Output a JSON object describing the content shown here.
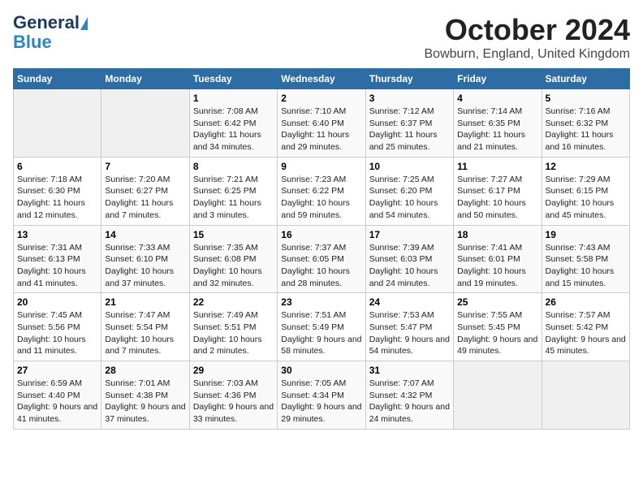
{
  "header": {
    "logo_line1": "General",
    "logo_line2": "Blue",
    "title": "October 2024",
    "subtitle": "Bowburn, England, United Kingdom"
  },
  "weekdays": [
    "Sunday",
    "Monday",
    "Tuesday",
    "Wednesday",
    "Thursday",
    "Friday",
    "Saturday"
  ],
  "weeks": [
    [
      {
        "day": "",
        "empty": true
      },
      {
        "day": "",
        "empty": true
      },
      {
        "day": "1",
        "sunrise": "7:08 AM",
        "sunset": "6:42 PM",
        "daylight": "11 hours and 34 minutes."
      },
      {
        "day": "2",
        "sunrise": "7:10 AM",
        "sunset": "6:40 PM",
        "daylight": "11 hours and 29 minutes."
      },
      {
        "day": "3",
        "sunrise": "7:12 AM",
        "sunset": "6:37 PM",
        "daylight": "11 hours and 25 minutes."
      },
      {
        "day": "4",
        "sunrise": "7:14 AM",
        "sunset": "6:35 PM",
        "daylight": "11 hours and 21 minutes."
      },
      {
        "day": "5",
        "sunrise": "7:16 AM",
        "sunset": "6:32 PM",
        "daylight": "11 hours and 16 minutes."
      }
    ],
    [
      {
        "day": "6",
        "sunrise": "7:18 AM",
        "sunset": "6:30 PM",
        "daylight": "11 hours and 12 minutes."
      },
      {
        "day": "7",
        "sunrise": "7:20 AM",
        "sunset": "6:27 PM",
        "daylight": "11 hours and 7 minutes."
      },
      {
        "day": "8",
        "sunrise": "7:21 AM",
        "sunset": "6:25 PM",
        "daylight": "11 hours and 3 minutes."
      },
      {
        "day": "9",
        "sunrise": "7:23 AM",
        "sunset": "6:22 PM",
        "daylight": "10 hours and 59 minutes."
      },
      {
        "day": "10",
        "sunrise": "7:25 AM",
        "sunset": "6:20 PM",
        "daylight": "10 hours and 54 minutes."
      },
      {
        "day": "11",
        "sunrise": "7:27 AM",
        "sunset": "6:17 PM",
        "daylight": "10 hours and 50 minutes."
      },
      {
        "day": "12",
        "sunrise": "7:29 AM",
        "sunset": "6:15 PM",
        "daylight": "10 hours and 45 minutes."
      }
    ],
    [
      {
        "day": "13",
        "sunrise": "7:31 AM",
        "sunset": "6:13 PM",
        "daylight": "10 hours and 41 minutes."
      },
      {
        "day": "14",
        "sunrise": "7:33 AM",
        "sunset": "6:10 PM",
        "daylight": "10 hours and 37 minutes."
      },
      {
        "day": "15",
        "sunrise": "7:35 AM",
        "sunset": "6:08 PM",
        "daylight": "10 hours and 32 minutes."
      },
      {
        "day": "16",
        "sunrise": "7:37 AM",
        "sunset": "6:05 PM",
        "daylight": "10 hours and 28 minutes."
      },
      {
        "day": "17",
        "sunrise": "7:39 AM",
        "sunset": "6:03 PM",
        "daylight": "10 hours and 24 minutes."
      },
      {
        "day": "18",
        "sunrise": "7:41 AM",
        "sunset": "6:01 PM",
        "daylight": "10 hours and 19 minutes."
      },
      {
        "day": "19",
        "sunrise": "7:43 AM",
        "sunset": "5:58 PM",
        "daylight": "10 hours and 15 minutes."
      }
    ],
    [
      {
        "day": "20",
        "sunrise": "7:45 AM",
        "sunset": "5:56 PM",
        "daylight": "10 hours and 11 minutes."
      },
      {
        "day": "21",
        "sunrise": "7:47 AM",
        "sunset": "5:54 PM",
        "daylight": "10 hours and 7 minutes."
      },
      {
        "day": "22",
        "sunrise": "7:49 AM",
        "sunset": "5:51 PM",
        "daylight": "10 hours and 2 minutes."
      },
      {
        "day": "23",
        "sunrise": "7:51 AM",
        "sunset": "5:49 PM",
        "daylight": "9 hours and 58 minutes."
      },
      {
        "day": "24",
        "sunrise": "7:53 AM",
        "sunset": "5:47 PM",
        "daylight": "9 hours and 54 minutes."
      },
      {
        "day": "25",
        "sunrise": "7:55 AM",
        "sunset": "5:45 PM",
        "daylight": "9 hours and 49 minutes."
      },
      {
        "day": "26",
        "sunrise": "7:57 AM",
        "sunset": "5:42 PM",
        "daylight": "9 hours and 45 minutes."
      }
    ],
    [
      {
        "day": "27",
        "sunrise": "6:59 AM",
        "sunset": "4:40 PM",
        "daylight": "9 hours and 41 minutes."
      },
      {
        "day": "28",
        "sunrise": "7:01 AM",
        "sunset": "4:38 PM",
        "daylight": "9 hours and 37 minutes."
      },
      {
        "day": "29",
        "sunrise": "7:03 AM",
        "sunset": "4:36 PM",
        "daylight": "9 hours and 33 minutes."
      },
      {
        "day": "30",
        "sunrise": "7:05 AM",
        "sunset": "4:34 PM",
        "daylight": "9 hours and 29 minutes."
      },
      {
        "day": "31",
        "sunrise": "7:07 AM",
        "sunset": "4:32 PM",
        "daylight": "9 hours and 24 minutes."
      },
      {
        "day": "",
        "empty": true
      },
      {
        "day": "",
        "empty": true
      }
    ]
  ],
  "labels": {
    "sunrise": "Sunrise:",
    "sunset": "Sunset:",
    "daylight": "Daylight:"
  }
}
